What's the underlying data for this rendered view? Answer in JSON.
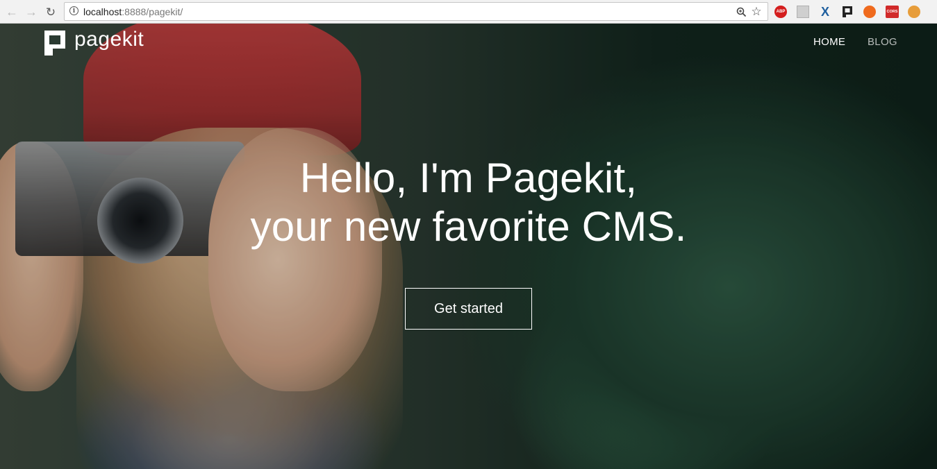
{
  "browser": {
    "url_host": "localhost",
    "url_path": ":8888/pagekit/",
    "extensions": [
      {
        "name": "adblock-plus",
        "label": "ABP"
      },
      {
        "name": "cors",
        "label": "CORS"
      }
    ],
    "icons": {
      "back": "back-arrow-icon",
      "forward": "forward-arrow-icon",
      "reload": "reload-icon",
      "info": "info-icon",
      "zoom": "zoom-icon",
      "bookmark": "star-icon"
    }
  },
  "site": {
    "logo_text": "pagekit",
    "nav": [
      {
        "label": "HOME",
        "active": true
      },
      {
        "label": "BLOG",
        "active": false
      }
    ]
  },
  "hero": {
    "line1": "Hello, I'm Pagekit,",
    "line2": "your new favorite CMS.",
    "cta_label": "Get started"
  },
  "colors": {
    "text_primary": "#ffffff",
    "nav_inactive": "rgba(255,255,255,0.7)"
  }
}
